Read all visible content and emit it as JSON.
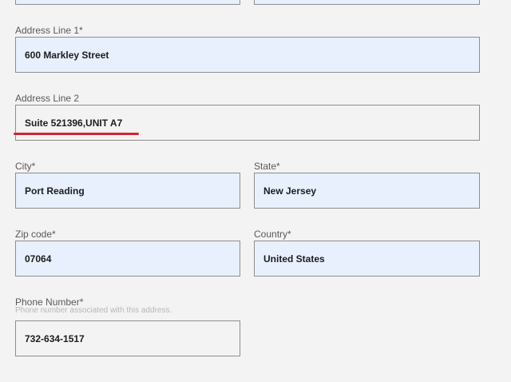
{
  "form": {
    "address1": {
      "label": "Address Line 1*",
      "value": "600 Markley Street"
    },
    "address2": {
      "label": "Address Line 2",
      "value": "Suite 521396,UNIT A7"
    },
    "city": {
      "label": "City*",
      "value": "Port Reading"
    },
    "state": {
      "label": "State*",
      "value": "New Jersey"
    },
    "zip": {
      "label": "Zip code*",
      "value": "07064"
    },
    "country": {
      "label": "Country*",
      "value": "United States"
    },
    "phone": {
      "label": "Phone Number*",
      "hint": "Phone number associated with this address.",
      "value": "732-634-1517"
    }
  },
  "colors": {
    "autofill_background": "#e8f0fe",
    "page_background": "#f3f3f3",
    "annotation_underline": "#d32431"
  }
}
